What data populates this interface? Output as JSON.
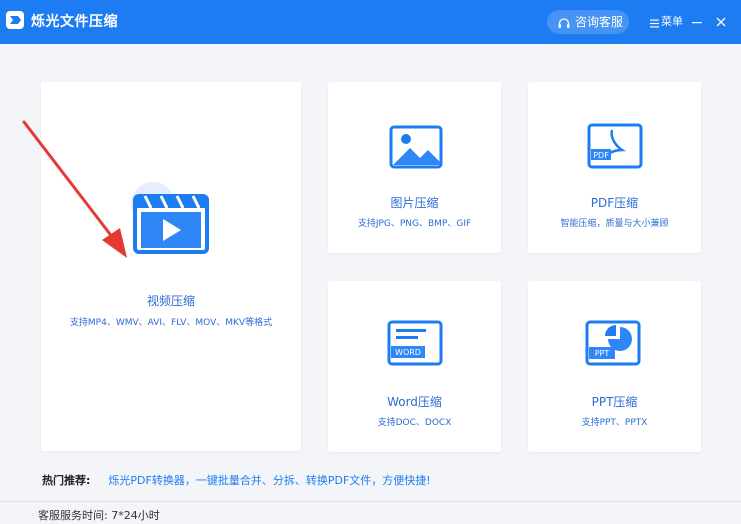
{
  "app": {
    "title": "烁光文件压缩"
  },
  "header": {
    "support_label": "咨询客服",
    "menu_label": "菜单"
  },
  "cards": {
    "video": {
      "title": "视频压缩",
      "formats": "支持MP4、WMV、AVI、FLV、MOV、MKV等格式"
    },
    "image": {
      "title": "图片压缩",
      "formats": "支持JPG、PNG、BMP、GIF"
    },
    "pdf": {
      "title": "PDF压缩",
      "formats": "智能压缩，质量与大小兼顾",
      "icon_text": "PDF"
    },
    "word": {
      "title": "Word压缩",
      "formats": "支持DOC、DOCX",
      "icon_text": "WORD"
    },
    "ppt": {
      "title": "PPT压缩",
      "formats": "支持PPT、PPTX",
      "icon_text": "PPT"
    }
  },
  "hot": {
    "label": "热门推荐:",
    "link": "烁光PDF转换器，一键批量合并、分拆、转换PDF文件，方便快捷!"
  },
  "footer": {
    "service_hours": "客服服务时间: 7*24小时"
  },
  "colors": {
    "titlebar": "#1d7cf2",
    "accent_text": "#2c6bd6",
    "annotation_arrow": "#e53935"
  }
}
